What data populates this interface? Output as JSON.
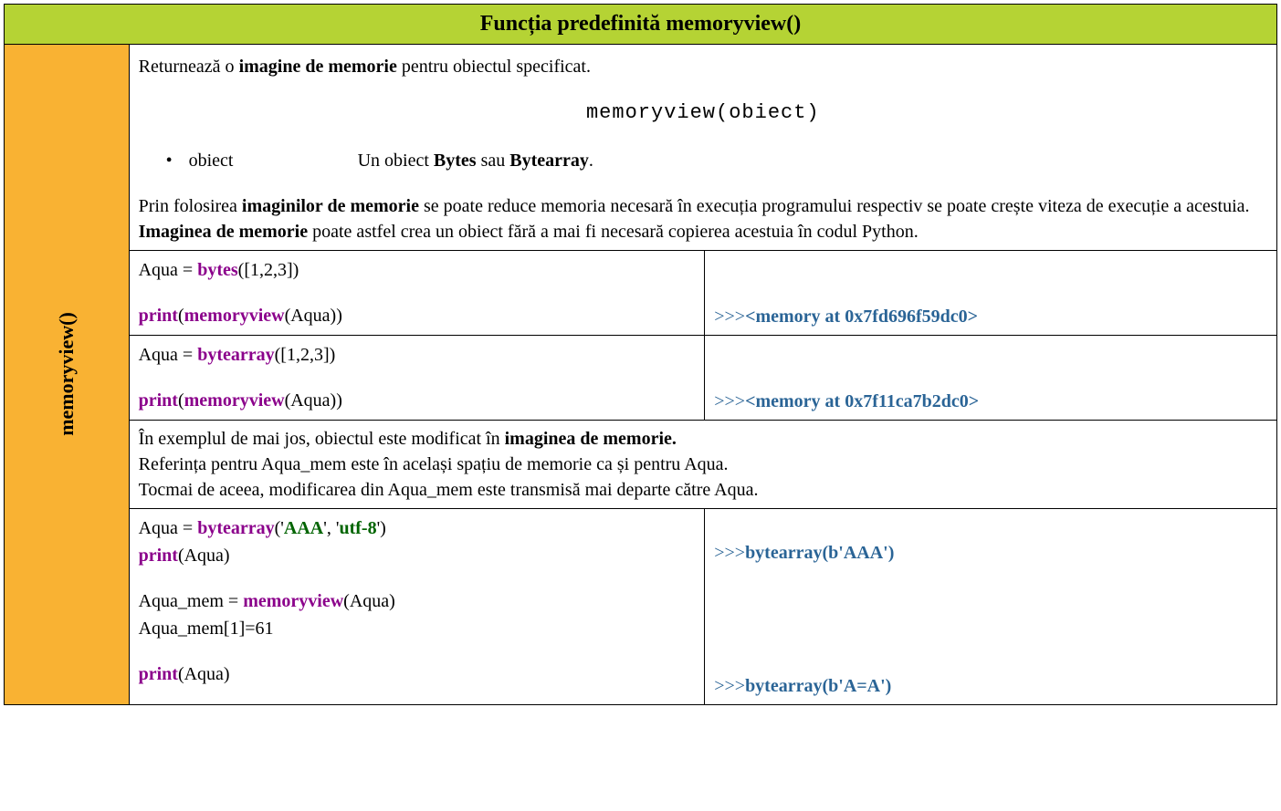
{
  "header": {
    "title": "Funcția predefinită memoryview()"
  },
  "sidebar": {
    "label": "memoryview()"
  },
  "description": {
    "intro_pre": "Returnează o ",
    "intro_bold": "imagine de memorie",
    "intro_post": " pentru obiectul specificat.",
    "syntax": "memoryview(obiect)",
    "param_name": "obiect",
    "param_desc_pre": "Un obiect ",
    "param_desc_b1": "Bytes",
    "param_desc_mid": " sau ",
    "param_desc_b2": "Bytearray",
    "param_desc_post": ".",
    "p2_pre": "Prin folosirea ",
    "p2_b": "imaginilor de memorie",
    "p2_post": " se poate reduce memoria necesară în execuția programului respectiv se poate crește viteza de execuție a acestuia.",
    "p3_b": "Imaginea de memorie",
    "p3_post": " poate astfel crea un obiect fără a mai fi necesară copierea acestuia în codul Python."
  },
  "ex1": {
    "line1_pre": "Aqua = ",
    "line1_kw": "bytes",
    "line1_post": "([1,2,3])",
    "line2_kw1": "print",
    "line2_mid": "(",
    "line2_kw2": "memoryview",
    "line2_post": "(Aqua))",
    "out_prompt": ">>>",
    "out_text": "<memory at 0x7fd696f59dc0>"
  },
  "ex2": {
    "line1_pre": "Aqua = ",
    "line1_kw": "bytearray",
    "line1_post": "([1,2,3])",
    "line2_kw1": "print",
    "line2_mid": "(",
    "line2_kw2": "memoryview",
    "line2_post": "(Aqua))",
    "out_prompt": ">>>",
    "out_text": "<memory at 0x7f11ca7b2dc0>"
  },
  "explain": {
    "l1_pre": "În exemplul de mai jos, obiectul este modificat în ",
    "l1_b": "imaginea de memorie.",
    "l2": "Referința pentru Aqua_mem este în același spațiu de memorie ca și pentru Aqua.",
    "l3": "Tocmai de aceea, modificarea din Aqua_mem este transmisă mai departe către Aqua."
  },
  "ex3": {
    "l1_pre": "Aqua = ",
    "l1_kw": "bytearray",
    "l1_p1": "('",
    "l1_s1": "AAA",
    "l1_p2": "', '",
    "l1_s2": "utf-8",
    "l1_p3": "')",
    "l2_kw": "print",
    "l2_post": "(Aqua)",
    "l3_pre": "Aqua_mem = ",
    "l3_kw": "memoryview",
    "l3_post": "(Aqua)",
    "l4": "Aqua_mem[1]=61",
    "l5_kw": "print",
    "l5_post": "(Aqua)",
    "out1_prompt": ">>>",
    "out1_text": "bytearray(b'AAA')",
    "out2_prompt": ">>>",
    "out2_text": "bytearray(b'A=A')"
  }
}
